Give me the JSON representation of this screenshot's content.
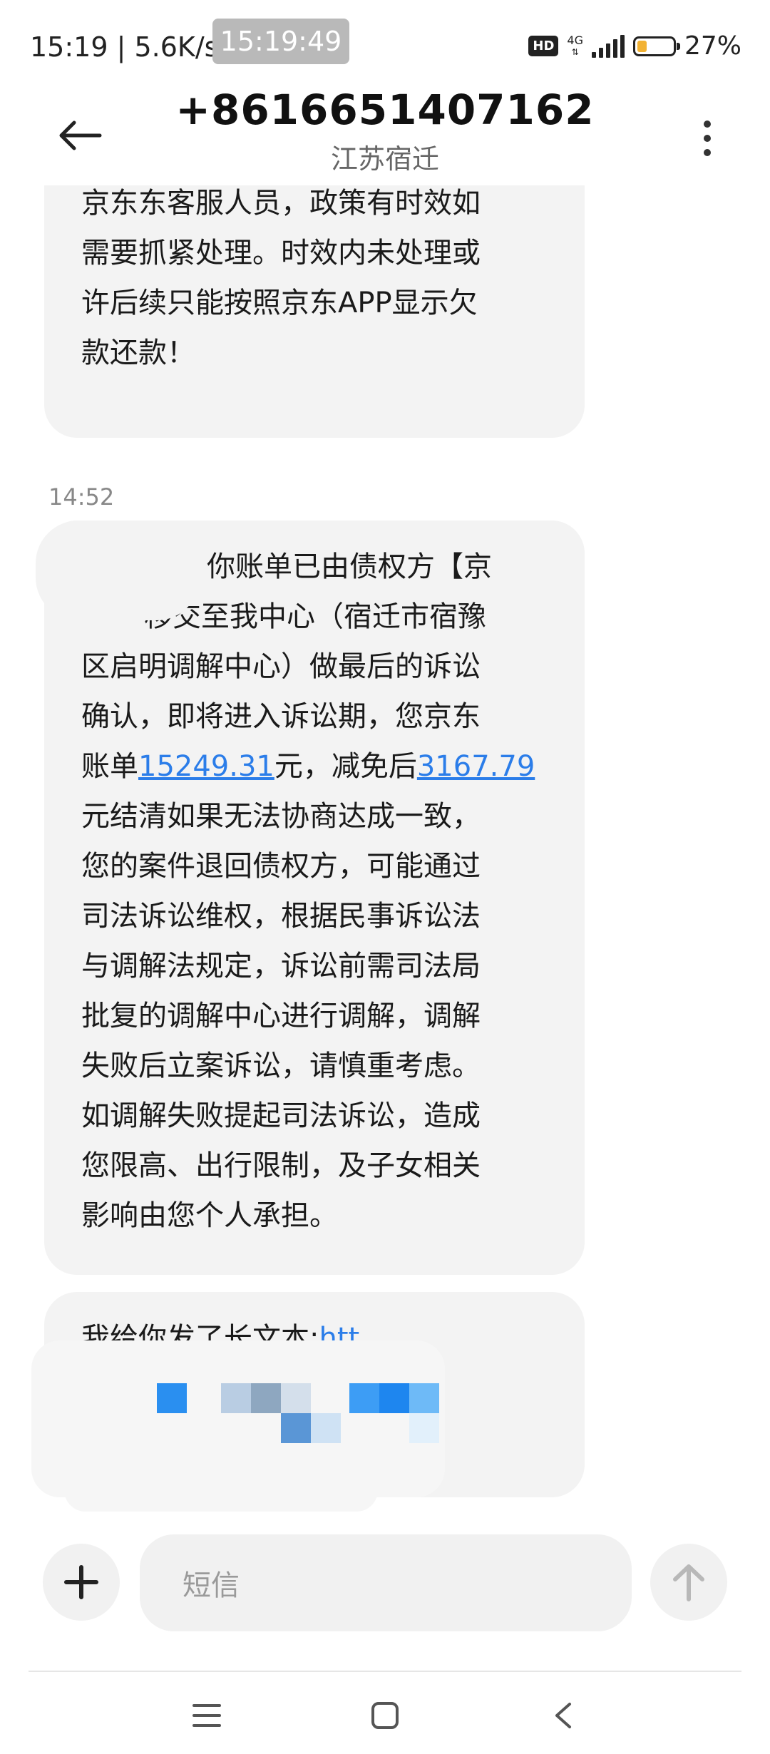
{
  "status_bar": {
    "left_text": "15:19 | 5.6K/s",
    "time_chip": "15:19:49",
    "hd_badge": "HD",
    "network": "4G",
    "battery_level": 0.27,
    "battery_text": "27%",
    "battery_color": "#f2b233"
  },
  "header": {
    "title": "+8616651407162",
    "subtitle": "江苏宿迁",
    "back_icon": "back-arrow-icon",
    "more_icon": "more-vert-icon"
  },
  "messages": {
    "first_lines": [
      "京东东客服人员，政策有时效如",
      "需要抓紧处理。时效内未处理或",
      "许后续只能按照京东APP显示欠",
      "款还款！"
    ],
    "timestamp": "14:52",
    "second": {
      "line1": "你账单已由债权方【京",
      "line2": "移交至我中心（宿迁市宿豫",
      "line3": "区启明调解中心）做最后的诉讼",
      "line4": "确认，即将进入诉讼期，您京东",
      "line5_a": "账单",
      "amount1": "15249.31",
      "line5_b": "元，减免后",
      "amount2": "3167.79",
      "line6": "元结清如果无法协商达成一致，",
      "line7": "您的案件退回债权方，可能通过",
      "line8": "司法诉讼维权，根据民事诉讼法",
      "line9": "与调解法规定，诉讼前需司法局",
      "line10": "批复的调解中心进行调解，调解",
      "line11": "失败后立案诉讼，请慎重考虑。",
      "line12": "如调解失败提起司法诉讼，造成",
      "line13": "您限高、出行限制，及子女相关",
      "line14": "影响由您个人承担。"
    },
    "third": {
      "prefix": "我给你发了长文本:",
      "link_start": "htt",
      "link_rest": "t211.qd.5"
    }
  },
  "input": {
    "placeholder": "短信",
    "add_icon": "plus-icon",
    "send_icon": "send-arrow-up-icon"
  },
  "nav": {
    "menu_icon": "menu-icon",
    "home_icon": "home-square-icon",
    "back_icon": "nav-back-icon"
  },
  "colors": {
    "bubble": "#f3f3f3",
    "link": "#2b7de9",
    "background": "#ffffff"
  }
}
